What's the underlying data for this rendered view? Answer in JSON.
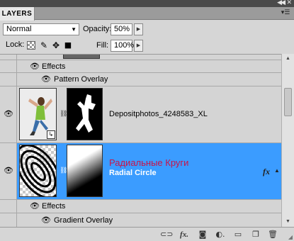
{
  "panel": {
    "tab_title": "LAYERS"
  },
  "options": {
    "blend_mode": "Normal",
    "opacity_label": "Opacity:",
    "opacity_value": "50%",
    "lock_label": "Lock:",
    "fill_label": "Fill:",
    "fill_value": "100%"
  },
  "layers": {
    "top_effects_label": "Effects",
    "top_effect_item": "Pattern Overlay",
    "photo_layer_name": "Depositphotos_4248583_XL",
    "selected_layer_title": "Радиальные Круги",
    "selected_layer_name": "Radial Circle",
    "bottom_effects_label": "Effects",
    "bottom_effect_item": "Gradient Overlay"
  },
  "colors": {
    "selected_row": "#3b9cff",
    "selected_title": "#c8144a"
  },
  "icons": {
    "titlebar": [
      "collapse-panels-icon",
      "close-icon"
    ],
    "bottom": [
      "link-layers-icon",
      "add-style-icon",
      "add-mask-icon",
      "adjustment-layer-icon",
      "new-group-icon",
      "new-layer-icon",
      "delete-layer-icon"
    ]
  }
}
